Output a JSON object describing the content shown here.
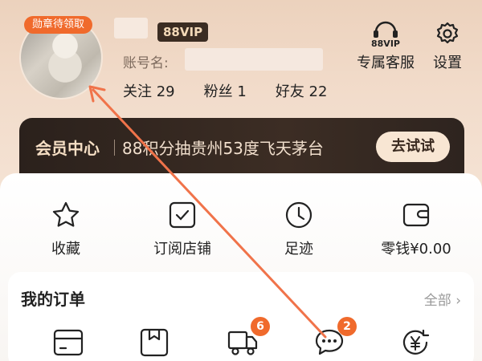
{
  "header": {
    "badge_pending": "勋章待领取",
    "vip_badge": "88VIP",
    "account_label": "账号名:",
    "stats": {
      "follow": "关注 29",
      "fans": "粉丝 1",
      "friends": "好友 22"
    },
    "service_label": "专属客服",
    "service_icon_text": "88VIP",
    "settings_label": "设置"
  },
  "member": {
    "title": "会员中心",
    "desc": "88积分抽贵州53度飞天茅台",
    "button": "去试试"
  },
  "quick": [
    {
      "label": "收藏",
      "icon": "star-icon"
    },
    {
      "label": "订阅店铺",
      "icon": "checkbox-icon"
    },
    {
      "label": "足迹",
      "icon": "clock-icon"
    },
    {
      "label": "零钱¥0.00",
      "icon": "wallet-icon"
    }
  ],
  "orders": {
    "title": "我的订单",
    "all": "全部 ›",
    "items": [
      {
        "icon": "card-payment-icon",
        "badge": ""
      },
      {
        "icon": "package-icon",
        "badge": ""
      },
      {
        "icon": "truck-icon",
        "badge": "6"
      },
      {
        "icon": "chat-bubble-icon",
        "badge": "2"
      },
      {
        "icon": "refund-yen-icon",
        "badge": ""
      }
    ]
  },
  "colors": {
    "accent": "#f06a2c",
    "banner_bg": "#2b211c",
    "banner_text": "#f6dfc5"
  }
}
